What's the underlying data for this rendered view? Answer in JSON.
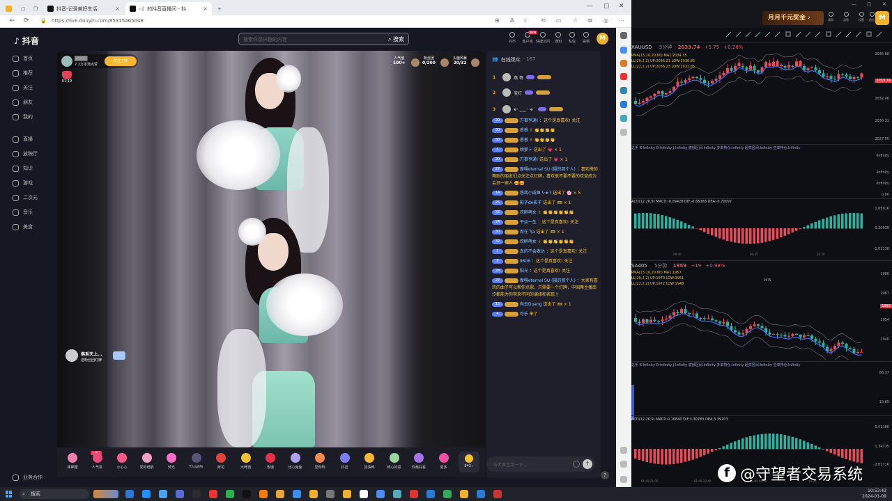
{
  "browser": {
    "tabs": [
      {
        "title": "抖音-记录美好生活"
      },
      {
        "title": "的抖音直播间 - 抖"
      }
    ],
    "url": "https://live.douyin.com/853154650​48"
  },
  "douyin": {
    "logo": "抖音",
    "nav": [
      "首页",
      "推荐",
      "关注",
      "朋友",
      "我的",
      "直播",
      "放映厅",
      "知识",
      "游戏",
      "二次元",
      "音乐",
      "美食"
    ],
    "footer": "业务合作",
    "search_placeholder": "搜索你感兴趣的内容",
    "search_button": "搜索",
    "top_icons": [
      "抖币",
      "客户端",
      "快捷访问",
      "通知",
      "私信",
      "投稿"
    ],
    "new_badge": "NEW"
  },
  "live": {
    "host_likes": "7.2万本场点赞",
    "follow_label": "关注主播",
    "rank_label": "01:19",
    "stats": [
      {
        "label": "人气值",
        "value": "100+"
      },
      {
        "label": "粉丝团",
        "value": "0/200"
      },
      {
        "label": "头脑风暴",
        "value": "20/32"
      }
    ],
    "gifter": {
      "name": "佛系天上...",
      "text": "送粉丝团灯牌"
    }
  },
  "gifts": [
    {
      "label": "棒棒糖",
      "color": "#f080b0"
    },
    {
      "label": "人气票",
      "color": "#e94a7b"
    },
    {
      "label": "小心心",
      "color": "#ff5a8a"
    },
    {
      "label": "爱的纸鹤",
      "color": "#f0a0c8"
    },
    {
      "label": "荧光",
      "color": "#ff6ec4"
    },
    {
      "label": "Thuglife",
      "color": "#555577"
    },
    {
      "label": "鲜花",
      "color": "#e0443c"
    },
    {
      "label": "大啤酒",
      "color": "#f3c233"
    },
    {
      "label": "玫瑰",
      "color": "#e8304a"
    },
    {
      "label": "比心兔兔",
      "color": "#b0a0f0"
    },
    {
      "label": "爱你哟",
      "color": "#f58a4a"
    },
    {
      "label": "抖音",
      "color": "#7a7cf0"
    },
    {
      "label": "加油鸭",
      "color": "#f7b733"
    },
    {
      "label": "称心如意",
      "color": "#9ad6a0"
    },
    {
      "label": "你最好看",
      "color": "#a474e8"
    },
    {
      "label": "更多",
      "color": "#f050a0"
    }
  ],
  "gift_hot": "上热门",
  "coin_count": "843",
  "chat": {
    "title": "在线观众",
    "count": "167",
    "top_users": [
      {
        "rank": "1",
        "name": "燕 哥"
      },
      {
        "rank": "2",
        "name": "宝灯"
      },
      {
        "rank": "3",
        "name": "ҽ˓ ‿‿ ˓ ҽ ᐝ"
      }
    ],
    "messages": [
      {
        "lv": "20",
        "name": "万事亨通!",
        "text": "：这个是真喜欢! 关注"
      },
      {
        "lv": "30",
        "name": "睿睿",
        "text": "✌ 👏👏👏👏"
      },
      {
        "lv": "30",
        "name": "睿睿",
        "text": "✌ 👏👏👏👏"
      },
      {
        "lv": "5",
        "name": "胡萝卜",
        "text": "送出了 💗 × 1"
      },
      {
        "lv": "20",
        "name": "万事亨通!",
        "text": "送出了 💗 × 1"
      },
      {
        "lv": "27",
        "name": "摩嘎eternal SU (摄的那个人)",
        "text": "：喜欢梅的舞蹈的朋友们点关注点灯牌，喜欢很不要不要的欢迎成为会员一家人 🥰🥰"
      },
      {
        "lv": "14",
        "name": "悠哉小咸鱼 ʕ·ᴥ·ʔ",
        "text": "送出了 🌸 × 5"
      },
      {
        "lv": "25",
        "name": "影子de影子",
        "text": "送出了 🎟 × 1"
      },
      {
        "lv": "32",
        "name": "欢醉萌女",
        "text": "✌ 👏👏👏👏👏👏"
      },
      {
        "lv": "24",
        "name": "平淡一生",
        "text": "：这个是真喜欢! 关注"
      },
      {
        "lv": "30",
        "name": "而在飞a",
        "text": "送出了 🎟 × 1"
      },
      {
        "lv": "32",
        "name": "欢醉萌女",
        "text": "✌ 👏👏👏👏👏👏"
      },
      {
        "lv": "2",
        "name": "真的不会表达",
        "text": "：这个是真喜欢! 关注"
      },
      {
        "lv": "8",
        "name": "9606",
        "text": "：这个是真喜欢! 关注"
      },
      {
        "lv": "24",
        "name": "阳光",
        "text": "：这个是真喜欢! 关注"
      },
      {
        "lv": "27",
        "name": "摩嘎eternal SU (摄的那个人)",
        "text": "：大家有喜欢的曲子可以帮你点歌，只需要一个灯牌，中国舞主播南汐都能为你带来不同的演绎和表现 🕯🕯"
      },
      {
        "lv": "15",
        "name": "向云Duang",
        "text": "送出了 🎟 × 1"
      },
      {
        "lv": "4",
        "name": "可乐",
        "text": "来了"
      }
    ],
    "input_placeholder": "与大家互动一下..."
  },
  "trading": {
    "promo": "月月千元奖金",
    "top_icons": [
      "通知",
      "消息",
      "设置",
      "退出"
    ],
    "pane1": {
      "symbol": "XAUUSD",
      "period": "5分钟",
      "price": "2033.74",
      "change": "+5.75",
      "pct": "+0.28%",
      "legend1": "PMA(13,10,20,60)  MA1:2034.35",
      "legend2": "LL(20,2,2)  UP:2036.21  LOW:2030.85",
      "legend3": "LL(22,2,2)  UP:2036.23  LOW:2031.85",
      "axis": [
        "2035.68",
        "2033.74",
        "2032.06",
        "2030.31",
        "2027.50"
      ],
      "ind_hdr": "之手  K:Infinity  D:Infinity  J:Infinity  底部区间:Infinity  多单持仓:Infinity  超买区间:Infinity  空单持仓:Infinity",
      "ind_axis": [
        "-Infinity",
        "-Infinity",
        "-Infinity",
        "0.00"
      ],
      "macd_hdr": "ACD(12,26,9)  MACD:-0.09428  DIF:-0.65383  DEA:-0.70097",
      "macd_axis": [
        "1.65016",
        "0.30939",
        "-1.03138"
      ],
      "time_labels": [
        "09:40",
        "09:45",
        "10:50"
      ]
    },
    "pane2": {
      "symbol": "SA405",
      "period": "5分钟",
      "price": "1959",
      "change": "+19",
      "pct": "+0.98%",
      "legend1": "PMA(13,10,20,60)  MA1:1957",
      "legend2": "LL(20,2,2)  UP:1970  LOW:1951",
      "legend3": "LL(22,2,2)  UP:1972  LOW:1948",
      "high_label": "1975",
      "axis": [
        "1980",
        "1967",
        "1959",
        "1954",
        "1940"
      ],
      "ind_hdr": "之手  K:Infinity  D:Infinity  J:Infinity  底部区间:Infinity  多单持仓:Infinity  超买区间:Infinity  空单持仓:Infinity",
      "ind_axis": [
        "86.37",
        "13.65"
      ],
      "macd_hdr": "ACD(12,26,9)  MACD:0.16840  DIF:3.30783  DEA:3.39203",
      "macd_axis": [
        "5.51186",
        "1.34735",
        "-2.81716"
      ],
      "time_labels": [
        "01-08 21:00",
        "01-08 22:40",
        "01-09 09:50",
        "10:35"
      ]
    },
    "watermark": "@守望者交易系统",
    "wm_logo": "f"
  },
  "taskbar": {
    "search": "搜索",
    "time": "10:53:43",
    "date": "2024-01-09"
  }
}
